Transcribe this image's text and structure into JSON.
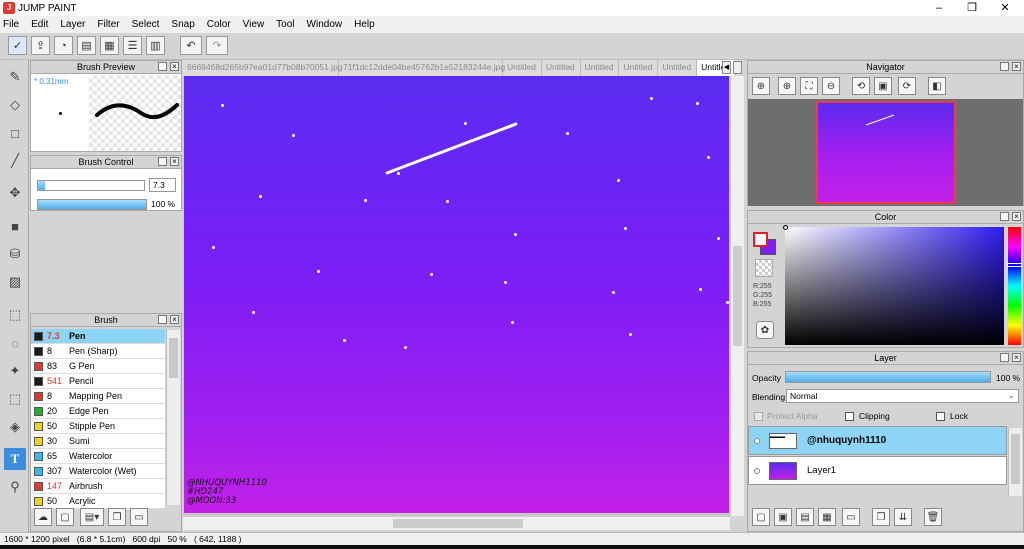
{
  "app": {
    "title": "JUMP PAINT",
    "window_buttons": [
      "–",
      "❐",
      "✕"
    ]
  },
  "menu": [
    "File",
    "Edit",
    "Layer",
    "Filter",
    "Select",
    "Snap",
    "Color",
    "View",
    "Tool",
    "Window",
    "Help"
  ],
  "tabs": [
    "6669468d265b97ea01d77b08b70051.jpg",
    "71f1dc12dde04be45762b1e52183244e.jpg",
    "Untitled",
    "Untitled",
    "Untitled",
    "Untitled",
    "Untitled",
    "Untitled"
  ],
  "brush_preview": {
    "title": "Brush Preview",
    "size_label": "* 0.31mm"
  },
  "brush_control": {
    "title": "Brush Control",
    "size_value": "7.3",
    "opacity_value": "100 %",
    "size_fraction": 0.07,
    "opacity_fraction": 1.0
  },
  "brush_panel": {
    "title": "Brush",
    "items": [
      {
        "size": "7.3",
        "name": "Pen",
        "color": "#1a1a1a",
        "size_color": "#e23b2e",
        "selected": true
      },
      {
        "size": "8",
        "name": "Pen (Sharp)",
        "color": "#1a1a1a",
        "size_color": "#000"
      },
      {
        "size": "83",
        "name": "G Pen",
        "color": "#e23b2e",
        "size_color": "#000"
      },
      {
        "size": "541",
        "name": "Pencil",
        "color": "#1a1a1a",
        "size_color": "#e23b2e"
      },
      {
        "size": "8",
        "name": "Mapping Pen",
        "color": "#e23b2e",
        "size_color": "#000"
      },
      {
        "size": "20",
        "name": "Edge Pen",
        "color": "#22b02a",
        "size_color": "#000"
      },
      {
        "size": "50",
        "name": "Stipple Pen",
        "color": "#f0d020",
        "size_color": "#000"
      },
      {
        "size": "30",
        "name": "Sumi",
        "color": "#f0d020",
        "size_color": "#000"
      },
      {
        "size": "65",
        "name": "Watercolor",
        "color": "#3ab8f0",
        "size_color": "#000"
      },
      {
        "size": "307",
        "name": "Watercolor (Wet)",
        "color": "#3ab8f0",
        "size_color": "#000"
      },
      {
        "size": "147",
        "name": "Airbrush",
        "color": "#e23b2e",
        "size_color": "#e23b2e"
      },
      {
        "size": "50",
        "name": "Acrylic",
        "color": "#f0d020",
        "size_color": "#000"
      }
    ]
  },
  "canvas": {
    "watermark": [
      "@NHUQUYNH1110",
      "#HD247",
      "@MOON:33"
    ]
  },
  "navigator": {
    "title": "Navigator"
  },
  "color_panel": {
    "title": "Color",
    "r": "R:255",
    "g": "G:255",
    "b": "B:255"
  },
  "layer_panel": {
    "title": "Layer",
    "opacity_label": "Opacity",
    "opacity_value": "100 %",
    "opacity_fraction": 1.0,
    "blending_label": "Blending",
    "blending_value": "Normal",
    "protect_alpha": "Protect Alpha",
    "clipping": "Clipping",
    "lock": "Lock",
    "layers": [
      {
        "name": "@nhuquynh1110",
        "selected": true
      },
      {
        "name": "Layer1",
        "selected": false
      }
    ]
  },
  "status": "1600 * 1200 pixel   (6.8 * 5.1cm)   600 dpi   50 %   ( 642, 1188 )",
  "colors": {
    "accent": "#3c8dde",
    "selected_row": "#8ed4f7",
    "canvas_top": "#5a2cf0",
    "canvas_bottom": "#c320e8"
  }
}
